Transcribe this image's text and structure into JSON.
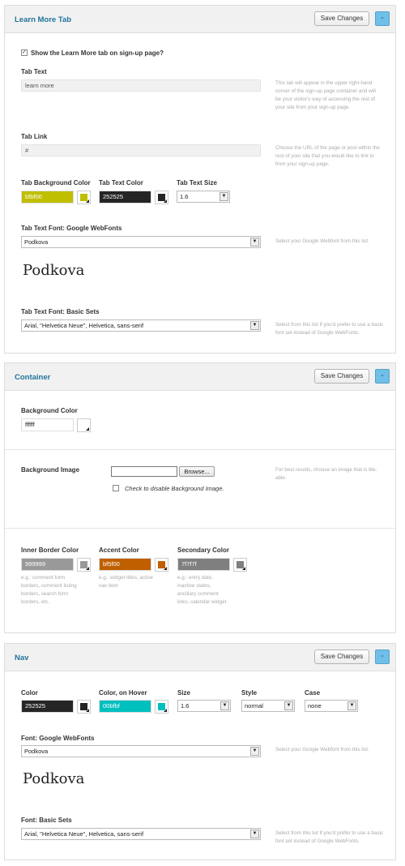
{
  "learn_more": {
    "title": "Learn More Tab",
    "save_label": "Save Changes",
    "collapse_label": "-",
    "show_tab_label": "Show the Learn More tab on sign-up page?",
    "tab_text_label": "Tab Text",
    "tab_text_value": "learn more",
    "tab_text_help": "This tab will appear in the upper right-hand corner of the sign-up page container and will be your visitor's way of accessing the rest of your site from your sign-up page.",
    "tab_link_label": "Tab Link",
    "tab_link_value": "#",
    "tab_link_help": "Choose the URL of the page or post within the rest of your site that you would like to link to from your sign-up page.",
    "bg_color_label": "Tab Background Color",
    "bg_color_value": "bfbf00",
    "text_color_label": "Tab Text Color",
    "text_color_value": "252525",
    "text_size_label": "Tab Text Size",
    "text_size_value": "1.6",
    "webfont_label": "Tab Text Font: Google WebFonts",
    "webfont_value": "Podkova",
    "webfont_help": "Select your Google Webfont from this list.",
    "webfont_preview": "Podkova",
    "basic_label": "Tab Text Font: Basic Sets",
    "basic_value": "Arial, \"Helvetica Neue\", Helvetica, sans-serif",
    "basic_help": "Select from this list if you'd prefer to use a basic font set instead of Google WebFonts.",
    "colors": {
      "bg": "#bfbf00",
      "text": "#252525"
    }
  },
  "container": {
    "title": "Container",
    "save_label": "Save Changes",
    "collapse_label": "-",
    "bg_color_label": "Background Color",
    "bg_color_value": "ffffff",
    "bg_image_label": "Background Image",
    "browse_label": "Browse...",
    "disable_bg_label": "Check to disable Background Image.",
    "bg_image_help": "For best results, choose an image that is tile-able.",
    "inner_border_label": "Inner Border Color",
    "inner_border_value": "999999",
    "inner_border_help": "e.g.: comment form borders, comment listing borders, search form borders, etc.",
    "accent_label": "Accent Color",
    "accent_value": "bf5f00",
    "accent_help": "e.g.: widget titles, active nav item",
    "secondary_label": "Secondary Color",
    "secondary_value": "7f7f7f",
    "secondary_help": "e.g.: entry date, inactive states, ancillary comment links, calendar widget.",
    "colors": {
      "inner_border": "#999999",
      "accent": "#bf5f00",
      "secondary": "#7f7f7f"
    }
  },
  "nav": {
    "title": "Nav",
    "save_label": "Save Changes",
    "collapse_label": "-",
    "color_label": "Color",
    "color_value": "252525",
    "hover_label": "Color, on Hover",
    "hover_value": "00bfbf",
    "size_label": "Size",
    "size_value": "1.6",
    "style_label": "Style",
    "style_value": "normal",
    "case_label": "Case",
    "case_value": "none",
    "webfont_label": "Font: Google WebFonts",
    "webfont_value": "Podkova",
    "webfont_help": "Select your Google Webfont from this list.",
    "webfont_preview": "Podkova",
    "basic_label": "Font: Basic Sets",
    "basic_value": "Arial, \"Helvetica Neue\", Helvetica, sans-serif",
    "basic_help": "Select from this list if you'd prefer to use a basic font set instead of Google WebFonts.",
    "colors": {
      "color": "#252525",
      "hover": "#00bfbf"
    }
  },
  "icons": {
    "collapse": "minus-icon",
    "checkbox": "checkmark-icon",
    "dropdown": "chevron-down-icon",
    "picker": "color-picker-icon"
  }
}
